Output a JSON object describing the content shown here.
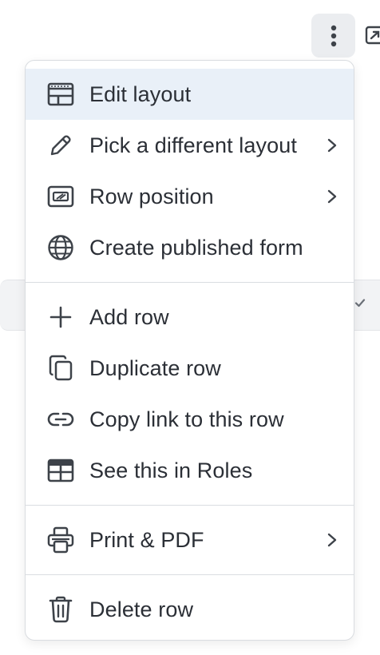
{
  "menu": {
    "groups": [
      [
        {
          "label": "Edit layout",
          "icon": "layout-icon",
          "active": true,
          "submenu": false
        },
        {
          "label": "Pick a different layout",
          "icon": "pencil-icon",
          "active": false,
          "submenu": true
        },
        {
          "label": "Row position",
          "icon": "row-position-icon",
          "active": false,
          "submenu": true
        },
        {
          "label": "Create published form",
          "icon": "globe-icon",
          "active": false,
          "submenu": false
        }
      ],
      [
        {
          "label": "Add row",
          "icon": "plus-icon",
          "active": false,
          "submenu": false
        },
        {
          "label": "Duplicate row",
          "icon": "duplicate-icon",
          "active": false,
          "submenu": false
        },
        {
          "label": "Copy link to this row",
          "icon": "link-icon",
          "active": false,
          "submenu": false
        },
        {
          "label": "See this in Roles",
          "icon": "table-icon",
          "active": false,
          "submenu": false
        }
      ],
      [
        {
          "label": "Print & PDF",
          "icon": "printer-icon",
          "active": false,
          "submenu": true
        }
      ],
      [
        {
          "label": "Delete row",
          "icon": "trash-icon",
          "active": false,
          "submenu": false
        }
      ]
    ]
  },
  "colors": {
    "active_bg": "#e9f0f8",
    "text": "#2b2f36",
    "icon": "#3d4249",
    "border": "#d9dce0"
  }
}
